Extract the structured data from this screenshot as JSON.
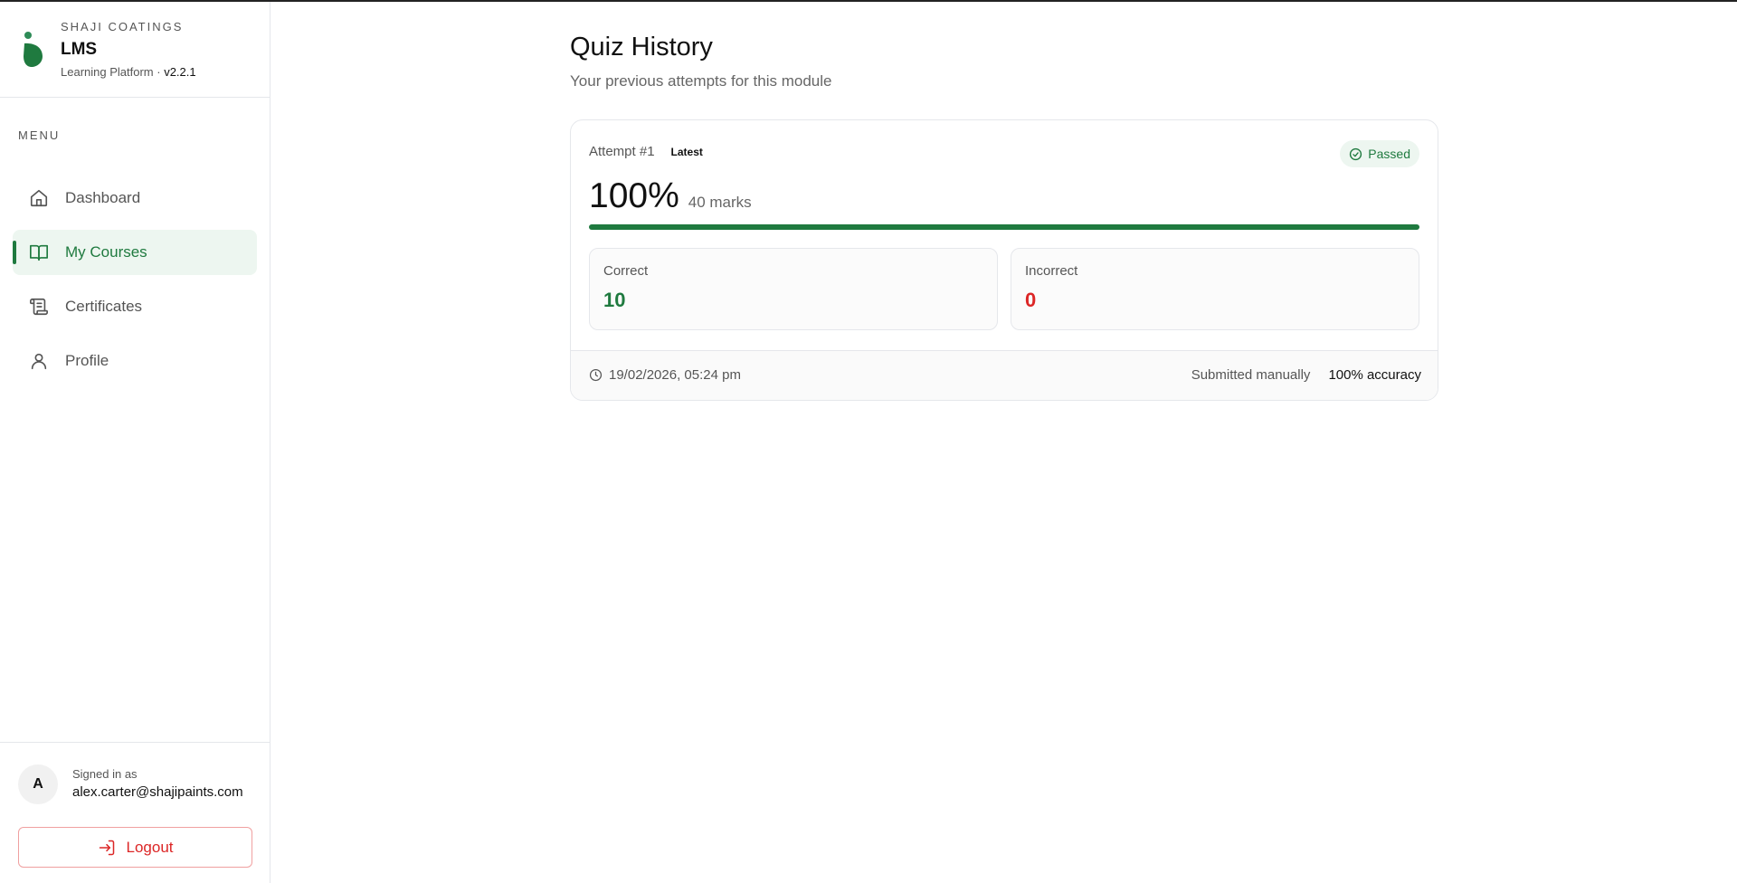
{
  "brand": {
    "company": "SHAJI COATINGS",
    "name": "LMS",
    "subtitle": "Learning Platform ·",
    "version": "v2.2.1",
    "accent_color": "#1f7a3f"
  },
  "sidebar": {
    "menu_title": "MENU",
    "items": [
      {
        "label": "Dashboard",
        "icon": "home-icon",
        "active": false
      },
      {
        "label": "My Courses",
        "icon": "book-open-icon",
        "active": true
      },
      {
        "label": "Certificates",
        "icon": "scroll-icon",
        "active": false
      },
      {
        "label": "Profile",
        "icon": "user-icon",
        "active": false
      }
    ]
  },
  "user": {
    "avatar_initial": "A",
    "signed_in_label": "Signed in as",
    "email": "alex.carter@shajipaints.com",
    "logout_label": "Logout"
  },
  "main": {
    "title": "Quiz History",
    "subtitle": "Your previous attempts for this module"
  },
  "attempt": {
    "label": "Attempt #1",
    "latest_badge": "Latest",
    "status": "Passed",
    "score_percent": "100%",
    "marks": "40 marks",
    "progress_fraction": 1.0,
    "correct_label": "Correct",
    "correct_value": "10",
    "incorrect_label": "Incorrect",
    "incorrect_value": "0",
    "timestamp": "19/02/2026, 05:24 pm",
    "submission": "Submitted manually",
    "accuracy": "100% accuracy"
  }
}
